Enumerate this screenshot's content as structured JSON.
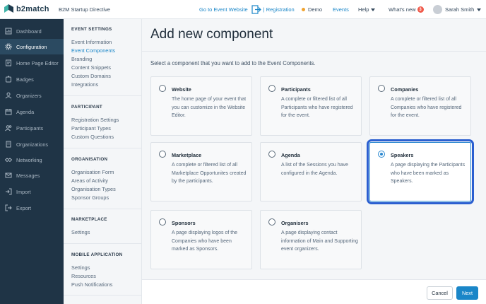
{
  "header": {
    "logo_text": "b2match",
    "event_name": "B2M Startup Directive",
    "goto_event": "Go to Event Website",
    "registration": "| Registration",
    "demo": "Demo",
    "events": "Events",
    "help": "Help",
    "whats_new": "What's new",
    "whats_new_count": "3",
    "user_name": "Sarah Smith"
  },
  "sidebar": {
    "items": [
      {
        "label": "Dashboard",
        "icon": "dashboard-icon"
      },
      {
        "label": "Configuration",
        "icon": "gear-icon"
      },
      {
        "label": "Home Page Editor",
        "icon": "home-page-icon"
      },
      {
        "label": "Badges",
        "icon": "badge-icon"
      },
      {
        "label": "Organizers",
        "icon": "organizers-icon"
      },
      {
        "label": "Agenda",
        "icon": "calendar-icon"
      },
      {
        "label": "Participants",
        "icon": "participants-icon"
      },
      {
        "label": "Organizations",
        "icon": "building-icon"
      },
      {
        "label": "Networking",
        "icon": "handshake-icon"
      },
      {
        "label": "Messages",
        "icon": "envelope-icon"
      },
      {
        "label": "Import",
        "icon": "import-icon"
      },
      {
        "label": "Export",
        "icon": "export-icon"
      }
    ],
    "active_index": 1
  },
  "submenu": {
    "sections": [
      {
        "heading": "EVENT SETTINGS",
        "items": [
          "Event Information",
          "Event Components",
          "Branding",
          "Content Snippets",
          "Custom Domains",
          "Integrations"
        ]
      },
      {
        "heading": "PARTICIPANT",
        "items": [
          "Registration Settings",
          "Participant Types",
          "Custom Questions"
        ]
      },
      {
        "heading": "ORGANISATION",
        "items": [
          "Organisation Form",
          "Areas of Activity",
          "Organisation Types",
          "Sponsor Groups"
        ]
      },
      {
        "heading": "MARKETPLACE",
        "items": [
          "Settings"
        ]
      },
      {
        "heading": "MOBILE APPLICATION",
        "items": [
          "Settings",
          "Resources",
          "Push Notifications"
        ]
      }
    ],
    "active": "Event Components"
  },
  "main": {
    "title": "Add new component",
    "instructions": "Select a component that you want to add to the Event Components.",
    "components": [
      {
        "title": "Website",
        "description": "The home page of your event that you can customize in the Website Editor.",
        "selected": false
      },
      {
        "title": "Participants",
        "description": "A complete or filtered list of all Participants who have registered for the event.",
        "selected": false
      },
      {
        "title": "Companies",
        "description": "A complete or filtered list of all Companies who have registered for the event.",
        "selected": false
      },
      {
        "title": "Marketplace",
        "description": "A complete or filtered list of all Marketplace Opportunites created by the participants.",
        "selected": false
      },
      {
        "title": "Agenda",
        "description": "A list of the Sessions you have configured in the Agenda.",
        "selected": false
      },
      {
        "title": "Speakers",
        "description": "A page displaying the Participants who have been marked as Speakers.",
        "selected": true
      },
      {
        "title": "Sponsors",
        "description": "A page displaying logos of the Companies who have been marked as Sponsors.",
        "selected": false
      },
      {
        "title": "Organisers",
        "description": "A page displaying contact information of Main and Supporting event organizers.",
        "selected": false
      }
    ]
  },
  "footer": {
    "cancel": "Cancel",
    "next": "Next"
  },
  "colors": {
    "accent": "#1a86c8",
    "sidebar_bg": "#1f3446",
    "highlight_ring": "#2a5fd0"
  }
}
